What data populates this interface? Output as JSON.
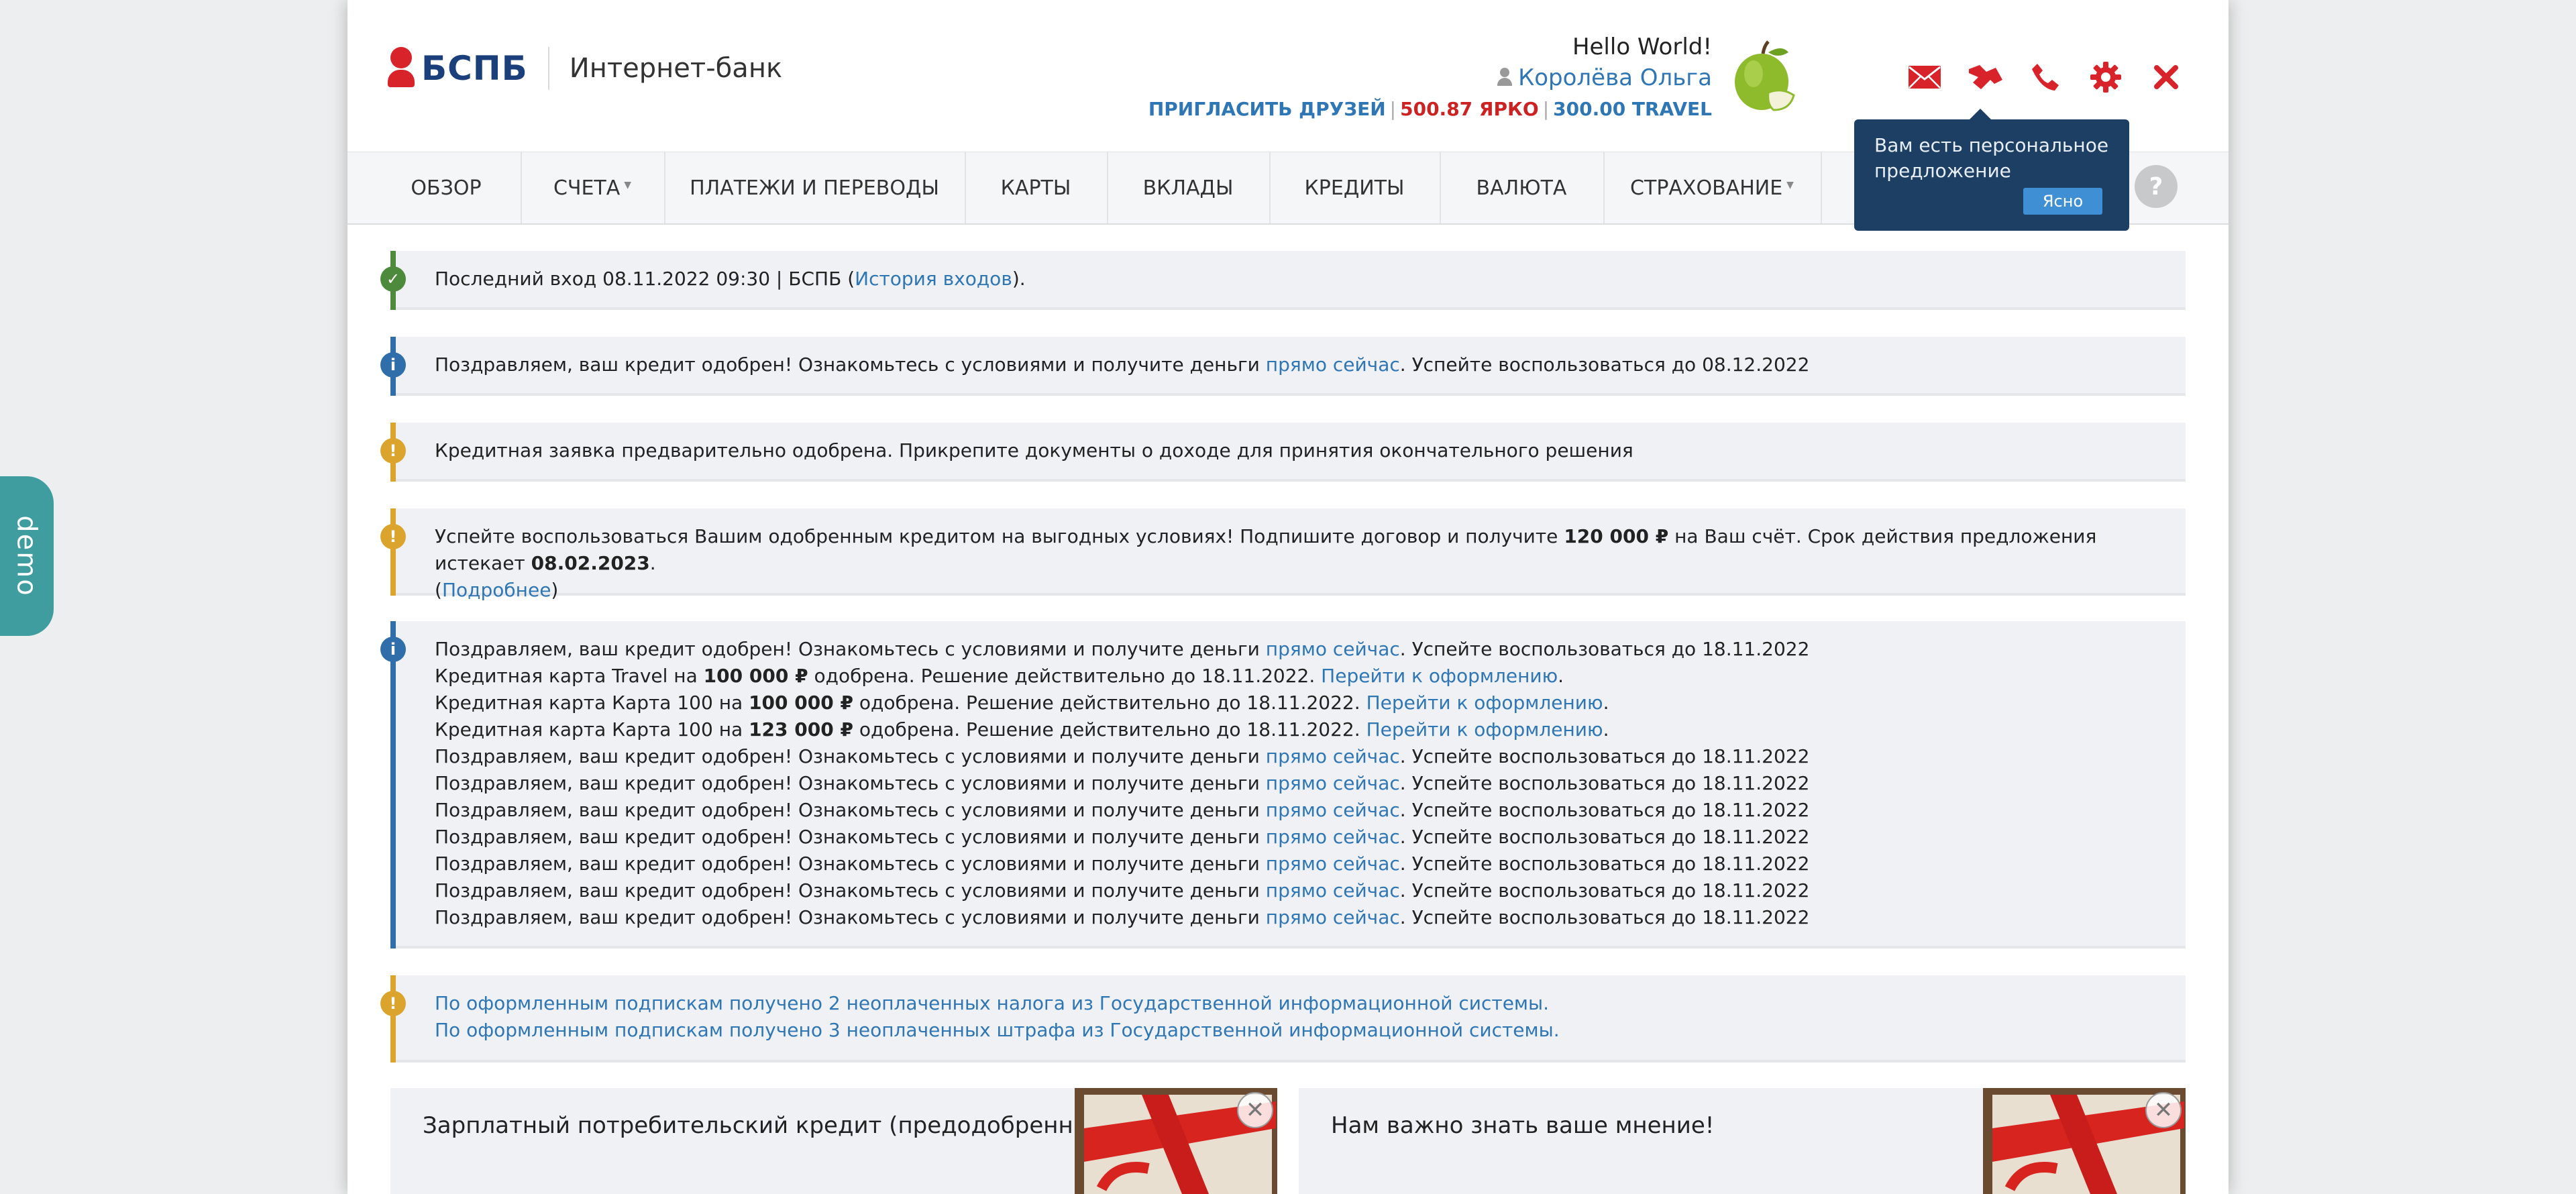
{
  "demo_tab": "demo",
  "header": {
    "logo_text": "БСПБ",
    "logo_subtitle": "Интернет-банк",
    "greeting": "Hello World!",
    "user_name": "Королёва Ольга",
    "invite_link": "ПРИГЛАСИТЬ ДРУЗЕЙ",
    "bonus_yarko": "500.87 ЯРКО",
    "bonus_travel": "300.00 TRAVEL",
    "icons": [
      "mail-icon",
      "offer-icon",
      "phone-icon",
      "settings-icon",
      "close-icon"
    ],
    "accent_color": "#d8232a"
  },
  "tooltip": {
    "text": "Вам есть персональное предложение",
    "button": "Ясно"
  },
  "nav": {
    "items": [
      {
        "label": "ОБЗОР"
      },
      {
        "label": "СЧЕТА"
      },
      {
        "label": "ПЛАТЕЖИ И ПЕРЕВОДЫ"
      },
      {
        "label": "КАРТЫ"
      },
      {
        "label": "ВКЛАДЫ"
      },
      {
        "label": "КРЕДИТЫ"
      },
      {
        "label": "ВАЛЮТА"
      },
      {
        "label": "СТРАХОВАНИЕ"
      }
    ],
    "help": "?"
  },
  "alerts": {
    "a1": {
      "prefix": "Последний вход 08.11.2022 09:30 | БСПБ (",
      "link": "История входов",
      "suffix": ")."
    },
    "a2": {
      "prefix": "Поздравляем, ваш кредит одобрен! Ознакомьтесь с условиями и получите деньги ",
      "link": "прямо сейчас",
      "suffix": ". Успейте воспользоваться до 08.12.2022"
    },
    "a3": {
      "text": "Кредитная заявка предварительно одобрена. Прикрепите документы о доходе для принятия окончательного решения"
    },
    "a4": {
      "t1": "Успейте воспользоваться Вашим одобренным кредитом на выгодных условиях! Подпишите договор и получите ",
      "amount": "120 000 ₽",
      "t2": " на Ваш счёт. Срок действия предложения истекает ",
      "date": "08.02.2023",
      "t3": ".",
      "t4": "(",
      "link": "Подробнее",
      "t5": ")"
    },
    "a5": {
      "congrats_prefix": "Поздравляем, ваш кредит одобрен! Ознакомьтесь с условиями и получите деньги ",
      "congrats_link": "прямо сейчас",
      "congrats_suffix": ". Успейте воспользоваться до 18.11.2022",
      "card1_prefix": "Кредитная карта Travel на ",
      "card1_amount": "100 000 ₽",
      "card2_prefix": "Кредитная карта Карта 100 на ",
      "card2_amount": "100 000 ₽",
      "card3_prefix": "Кредитная карта Карта 100 на ",
      "card3_amount": "123 000 ₽",
      "card_suffix": " одобрена. Решение действительно до 18.11.2022. ",
      "card_link": "Перейти к оформлению",
      "dot": "."
    },
    "a6": {
      "line1": "По оформленным подпискам получено 2 неоплаченных налога из Государственной информационной системы.",
      "line2": "По оформленным подпискам получено 3 неоплаченных штрафа из Государственной информационной системы."
    }
  },
  "cards": [
    {
      "title": "Зарплатный потребительский кредит (предодобренный)",
      "close": "✕"
    },
    {
      "title": "Нам важно знать ваше мнение!",
      "close": "✕"
    }
  ]
}
